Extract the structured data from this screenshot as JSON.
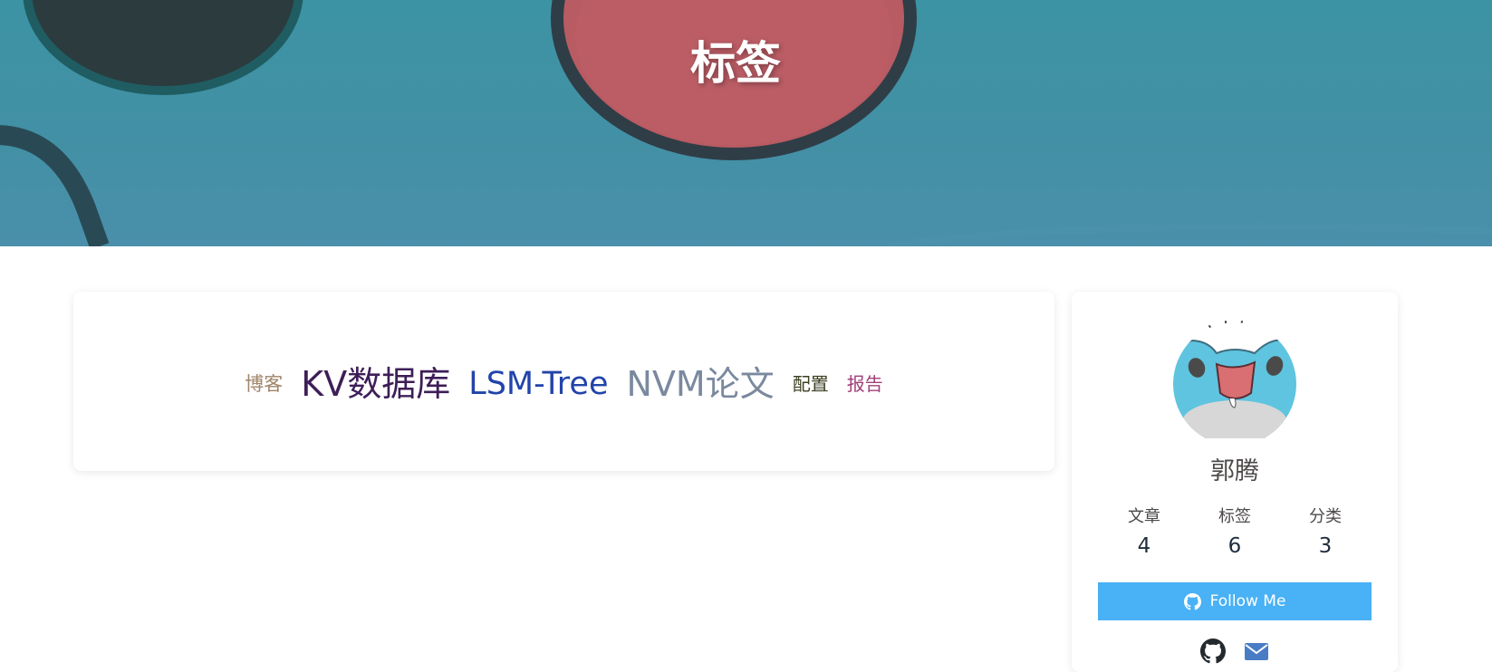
{
  "banner": {
    "title": "标签"
  },
  "tags": [
    {
      "label": "博客",
      "size": 21,
      "color": "#a0856a"
    },
    {
      "label": "KV数据库",
      "size": 38,
      "color": "#3e1e57"
    },
    {
      "label": "LSM-Tree",
      "size": 35,
      "color": "#2244aa"
    },
    {
      "label": "NVM论文",
      "size": 38,
      "color": "#7a899e"
    },
    {
      "label": "配置",
      "size": 20,
      "color": "#3d3f22"
    },
    {
      "label": "报告",
      "size": 20,
      "color": "#a0407a"
    }
  ],
  "profile": {
    "author_name": "郭腾",
    "stats": [
      {
        "label": "文章",
        "value": "4"
      },
      {
        "label": "标签",
        "value": "6"
      },
      {
        "label": "分类",
        "value": "3"
      }
    ],
    "follow_label": "Follow Me",
    "social_icons": [
      "github-icon",
      "email-icon"
    ]
  },
  "colors": {
    "accent": "#49b1f5",
    "banner": "#4390a5"
  }
}
